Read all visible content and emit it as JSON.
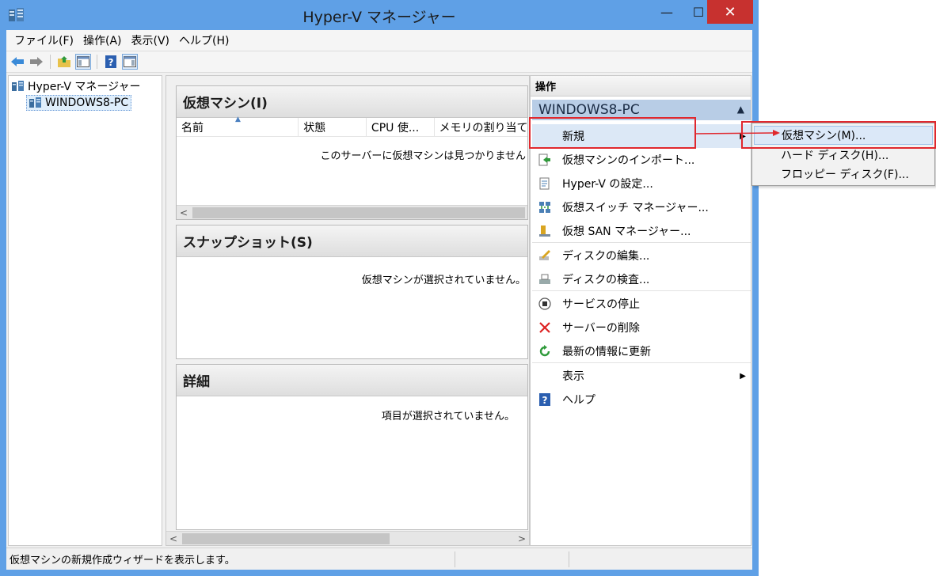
{
  "window": {
    "title": "Hyper-V マネージャー",
    "min_glyph": "—",
    "max_glyph": "☐",
    "close_glyph": "✕"
  },
  "menubar": {
    "items": [
      "ファイル(F)",
      "操作(A)",
      "表示(V)",
      "ヘルプ(H)"
    ]
  },
  "toolbar": {
    "buttons": [
      "back-icon",
      "forward-icon",
      "up-folder-icon",
      "show-hide-tree-icon",
      "help-icon",
      "show-hide-action-pane-icon"
    ]
  },
  "tree": {
    "root": "Hyper-V マネージャー",
    "child": "WINDOWS8-PC"
  },
  "vm_section": {
    "title": "仮想マシン(I)",
    "columns": [
      "名前",
      "状態",
      "CPU 使...",
      "メモリの割り当て"
    ],
    "empty_message": "このサーバーに仮想マシンは見つかりません"
  },
  "snapshot_section": {
    "title": "スナップショット(S)",
    "empty_message": "仮想マシンが選択されていません。"
  },
  "detail_section": {
    "title": "詳細",
    "empty_message": "項目が選択されていません。"
  },
  "actions": {
    "title": "操作",
    "group": "WINDOWS8-PC",
    "items": [
      {
        "label": "新規",
        "icon": "none"
      },
      {
        "label": "仮想マシンのインポート...",
        "icon": "import-icon"
      },
      {
        "label": "Hyper-V の設定...",
        "icon": "settings-icon"
      },
      {
        "label": "仮想スイッチ マネージャー...",
        "icon": "virtual-switch-icon"
      },
      {
        "label": "仮想 SAN マネージャー...",
        "icon": "san-icon"
      },
      {
        "label": "ディスクの編集...",
        "icon": "edit-disk-icon"
      },
      {
        "label": "ディスクの検査...",
        "icon": "inspect-disk-icon"
      },
      {
        "label": "サービスの停止",
        "icon": "stop-icon"
      },
      {
        "label": "サーバーの削除",
        "icon": "delete-icon"
      },
      {
        "label": "最新の情報に更新",
        "icon": "refresh-icon"
      },
      {
        "label": "表示",
        "icon": "none"
      },
      {
        "label": "ヘルプ",
        "icon": "help-icon"
      }
    ]
  },
  "flyout": {
    "items": [
      "仮想マシン(M)...",
      "ハード ディスク(H)...",
      "フロッピー ディスク(F)..."
    ]
  },
  "statusbar": {
    "text": "仮想マシンの新規作成ウィザードを表示します。"
  },
  "colors": {
    "window_frame": "#5fa0e6",
    "close_button": "#c7312f",
    "actions_group_bg": "#b8cde6",
    "annotation_red": "#e0282e"
  }
}
